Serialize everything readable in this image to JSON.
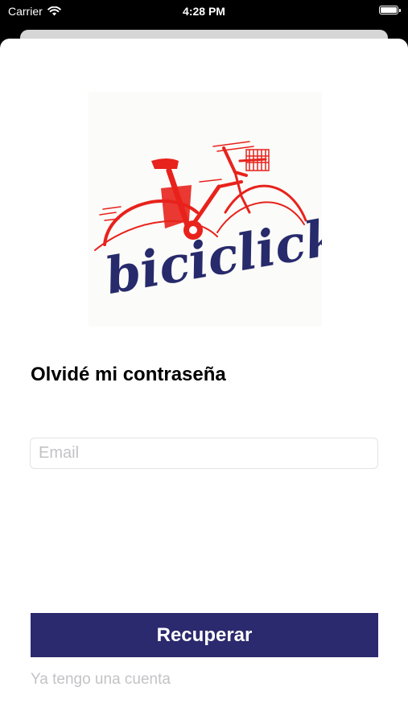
{
  "status_bar": {
    "carrier": "Carrier",
    "time": "4:28 PM",
    "icons": [
      "wifi-icon",
      "battery-icon"
    ]
  },
  "logo": {
    "wordmark": "biciclick",
    "colors": {
      "bike": "#e8221c",
      "wordmark": "#272a6b"
    }
  },
  "form": {
    "title": "Olvidé mi contraseña",
    "email_placeholder": "Email",
    "email_value": "",
    "submit_label": "Recuperar",
    "login_link": "Ya tengo una cuenta"
  },
  "colors": {
    "primary": "#2b2a6e",
    "placeholder": "#c3c3c7",
    "background": "#ffffff"
  }
}
